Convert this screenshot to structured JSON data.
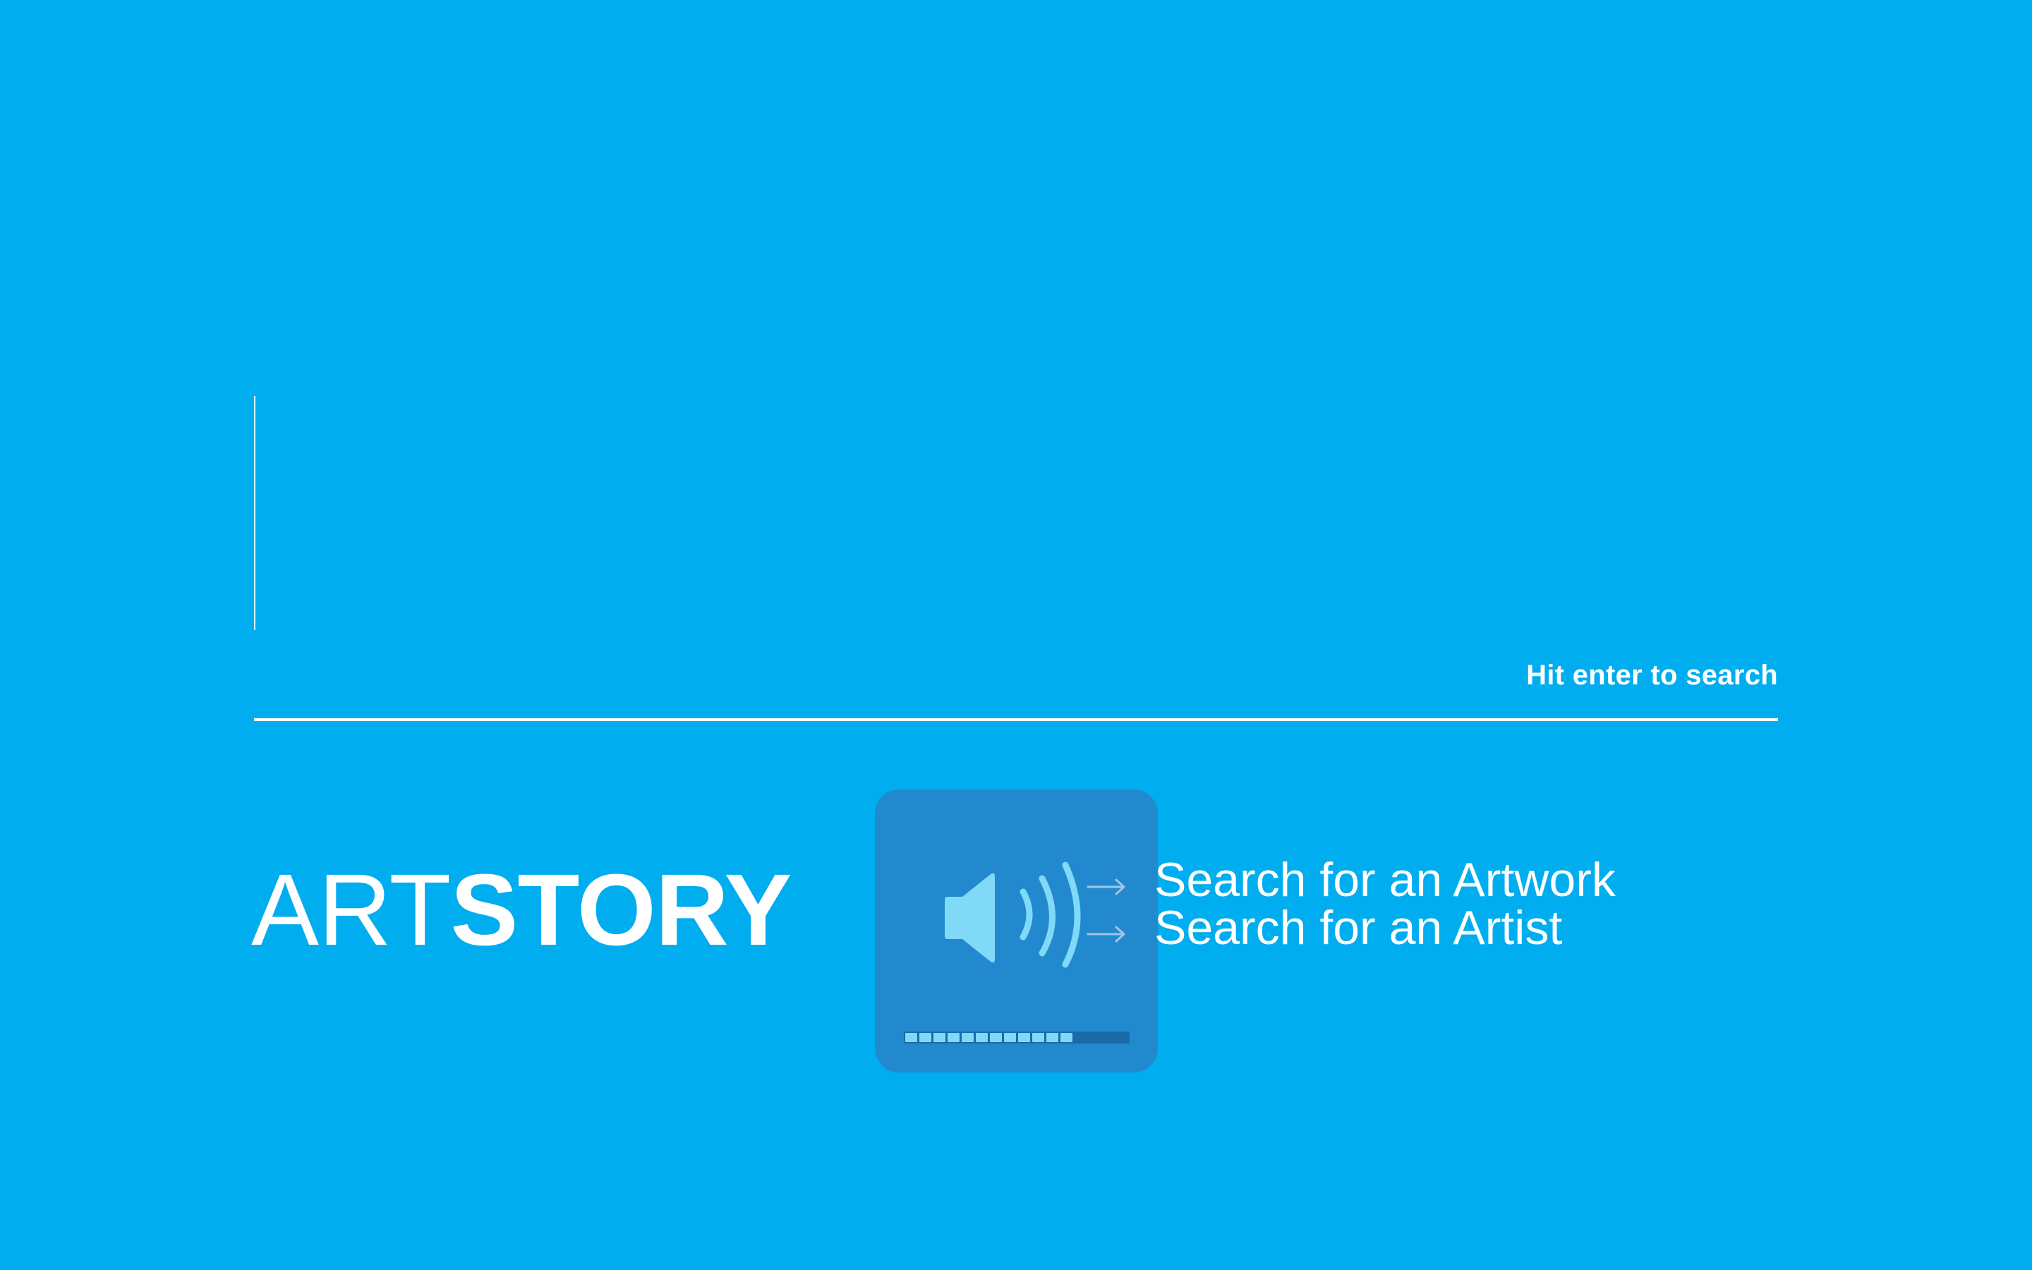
{
  "search": {
    "value": "",
    "placeholder": "",
    "hint": "Hit enter to search"
  },
  "logo": {
    "light": "ART",
    "bold": "STORY"
  },
  "volume_hud": {
    "icon": "speaker-volume-icon",
    "level": 0.75,
    "segments_total": 16
  },
  "search_options": [
    "Search for an Artwork",
    "Search for an Artist"
  ],
  "colors": {
    "background": "#00adef",
    "text": "#ffffff",
    "hud_background": "#2289cf",
    "hud_accent": "#7fd9f7"
  }
}
